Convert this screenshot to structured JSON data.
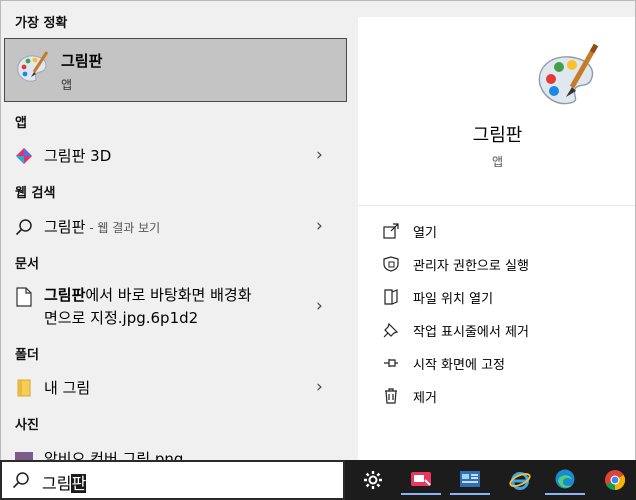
{
  "sections": {
    "best_match": "가장 정확",
    "apps": "앱",
    "web_search": "웹 검색",
    "documents": "문서",
    "folders": "폴더",
    "photos": "사진"
  },
  "best_match_item": {
    "title": "그림판",
    "subtitle": "앱"
  },
  "app_results": [
    {
      "name": "그림판 3D"
    }
  ],
  "web_result": {
    "query": "그림판",
    "hint": " - 웹 결과 보기"
  },
  "document_result": {
    "line1_bold": "그림판",
    "line1_rest": "에서 바로 바탕화면 배경화",
    "line2": "면으로 지정.jpg.6p1d2"
  },
  "folder_result": {
    "name": "내 그림"
  },
  "photo_result": {
    "name": "알비오 컨버 그림.png"
  },
  "detail_pane": {
    "title": "그림판",
    "subtitle": "앱",
    "actions": [
      {
        "label": "열기",
        "icon": "open-icon"
      },
      {
        "label": "관리자 권한으로 실행",
        "icon": "shield-icon"
      },
      {
        "label": "파일 위치 열기",
        "icon": "file-location-icon"
      },
      {
        "label": "작업 표시줄에서 제거",
        "icon": "unpin-taskbar-icon"
      },
      {
        "label": "시작 화면에 고정",
        "icon": "pin-icon"
      },
      {
        "label": "제거",
        "icon": "trash-icon"
      }
    ]
  },
  "search": {
    "value_prefix": "그림",
    "value_selected": "판"
  },
  "taskbar_items": [
    "settings-icon",
    "snip-app-icon",
    "news-app-icon",
    "ie-icon",
    "edge-icon",
    "chrome-icon"
  ],
  "colors": {
    "selection_bg": "#c4c4c4",
    "pane_bg": "#f0f0f0",
    "detail_bg": "#ffffff",
    "taskbar_bg": "#1c1c1c"
  }
}
